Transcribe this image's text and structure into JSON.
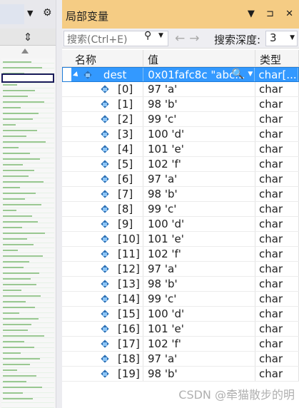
{
  "window": {
    "title": "局部变量"
  },
  "toolbar": {
    "search_placeholder": "搜索(Ctrl+E)",
    "depth_label": "搜索深度:",
    "depth_value": "3"
  },
  "columns": {
    "name": "名称",
    "value": "值",
    "type": "类型"
  },
  "dest": {
    "name": "dest",
    "value": "0x01fafc8c \"abc...",
    "type": "char[..."
  },
  "rows": [
    {
      "name": "[0]",
      "value": "97 'a'",
      "type": "char"
    },
    {
      "name": "[1]",
      "value": "98 'b'",
      "type": "char"
    },
    {
      "name": "[2]",
      "value": "99 'c'",
      "type": "char"
    },
    {
      "name": "[3]",
      "value": "100 'd'",
      "type": "char"
    },
    {
      "name": "[4]",
      "value": "101 'e'",
      "type": "char"
    },
    {
      "name": "[5]",
      "value": "102 'f'",
      "type": "char"
    },
    {
      "name": "[6]",
      "value": "97 'a'",
      "type": "char"
    },
    {
      "name": "[7]",
      "value": "98 'b'",
      "type": "char"
    },
    {
      "name": "[8]",
      "value": "99 'c'",
      "type": "char"
    },
    {
      "name": "[9]",
      "value": "100 'd'",
      "type": "char"
    },
    {
      "name": "[10]",
      "value": "101 'e'",
      "type": "char"
    },
    {
      "name": "[11]",
      "value": "102 'f'",
      "type": "char"
    },
    {
      "name": "[12]",
      "value": "97 'a'",
      "type": "char"
    },
    {
      "name": "[13]",
      "value": "98 'b'",
      "type": "char"
    },
    {
      "name": "[14]",
      "value": "99 'c'",
      "type": "char"
    },
    {
      "name": "[15]",
      "value": "100 'd'",
      "type": "char"
    },
    {
      "name": "[16]",
      "value": "101 'e'",
      "type": "char"
    },
    {
      "name": "[17]",
      "value": "102 'f'",
      "type": "char"
    },
    {
      "name": "[18]",
      "value": "97 'a'",
      "type": "char"
    },
    {
      "name": "[19]",
      "value": "98 'b'",
      "type": "char"
    }
  ],
  "watermark": "CSDN @牵猫散步的明",
  "colors": {
    "title_bar": "#f5cc84",
    "selection": "#3399ff"
  }
}
